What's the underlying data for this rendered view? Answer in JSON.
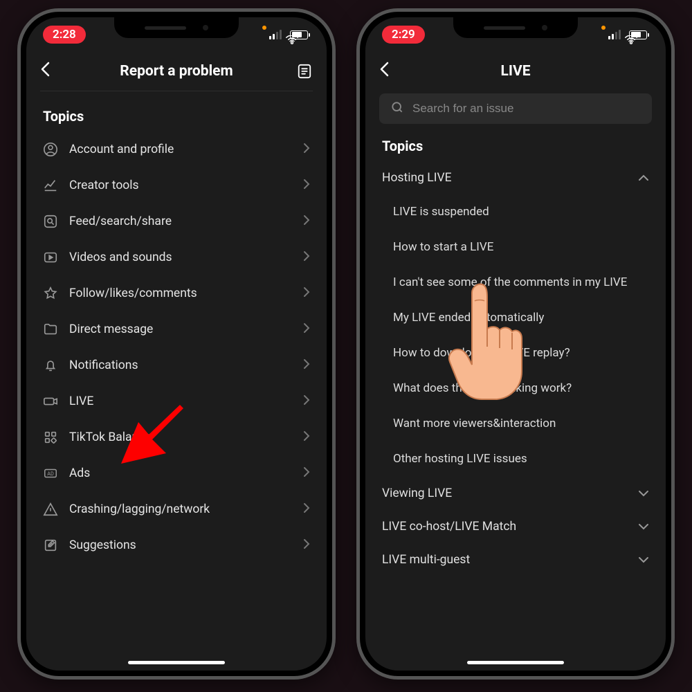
{
  "left": {
    "status_time": "2:28",
    "nav_title": "Report a problem",
    "section_title": "Topics",
    "items": [
      {
        "id": "account",
        "label": "Account and profile"
      },
      {
        "id": "creator",
        "label": "Creator tools"
      },
      {
        "id": "feed",
        "label": "Feed/search/share"
      },
      {
        "id": "videos",
        "label": "Videos and sounds"
      },
      {
        "id": "follow",
        "label": "Follow/likes/comments"
      },
      {
        "id": "dm",
        "label": "Direct message"
      },
      {
        "id": "notif",
        "label": "Notifications"
      },
      {
        "id": "live",
        "label": "LIVE"
      },
      {
        "id": "balance",
        "label": "TikTok Balance"
      },
      {
        "id": "ads",
        "label": "Ads"
      },
      {
        "id": "crash",
        "label": "Crashing/lagging/network"
      },
      {
        "id": "sugg",
        "label": "Suggestions"
      }
    ]
  },
  "right": {
    "status_time": "2:29",
    "nav_title": "LIVE",
    "search_placeholder": "Search for an issue",
    "section_title": "Topics",
    "expanded": {
      "title": "Hosting LIVE",
      "subs": [
        "LIVE is suspended",
        "How to start a LIVE",
        "I can't see some of the comments in my LIVE",
        "My LIVE ended automatically",
        "How to download my LIVE replay?",
        "What does the Host ranking work?",
        "Want more viewers&interaction",
        "Other hosting LIVE issues"
      ]
    },
    "collapsed": [
      "Viewing LIVE",
      "LIVE co-host/LIVE Match",
      "LIVE multi-guest"
    ]
  },
  "colors": {
    "accent_red": "#f22b3a",
    "arrow_red": "#fe0000",
    "skin": "#f8b890"
  }
}
